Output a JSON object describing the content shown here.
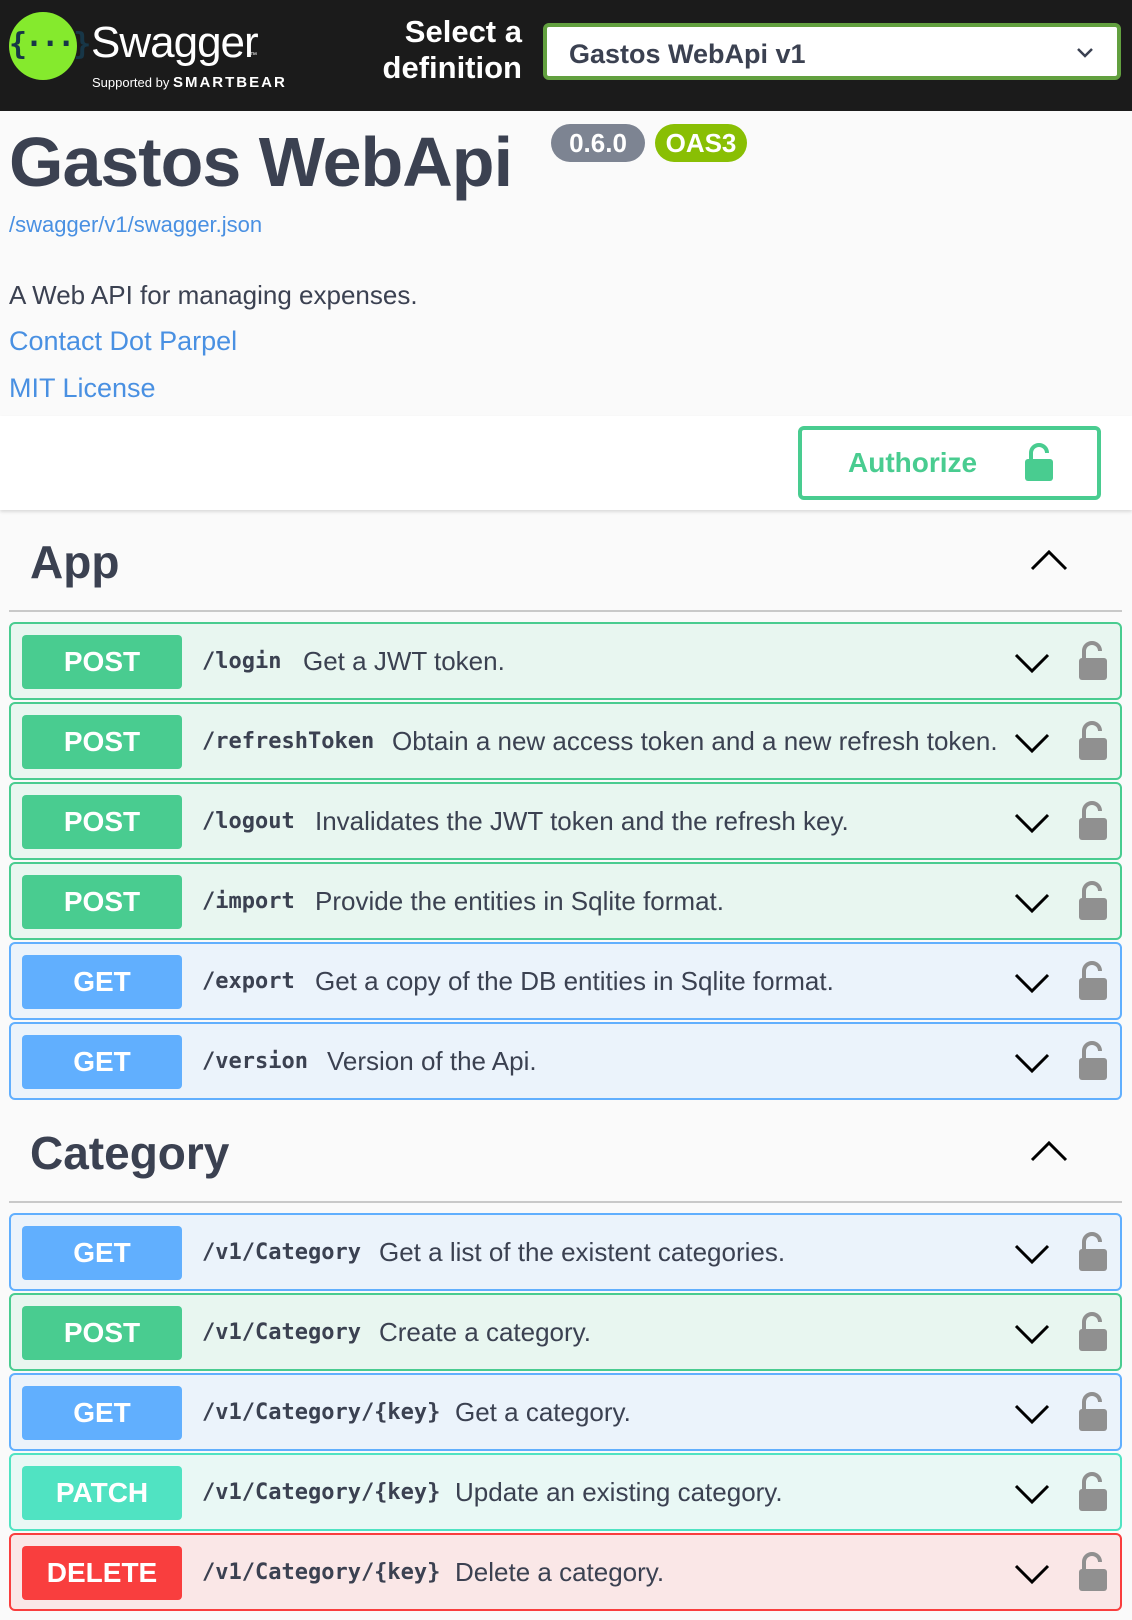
{
  "topbar": {
    "brand": "Swagger",
    "tm": "™",
    "supported_by": "Supported by",
    "company": "SMARTBEAR",
    "select_label_line1": "Select a",
    "select_label_line2": "definition",
    "selected_definition": "Gastos WebApi v1"
  },
  "info": {
    "title": "Gastos WebApi",
    "version": "0.6.0",
    "oas": "OAS3",
    "spec_link": "/swagger/v1/swagger.json",
    "description": "A Web API for managing expenses.",
    "contact": "Contact Dot Parpel",
    "license": "MIT License"
  },
  "auth": {
    "label": "Authorize"
  },
  "colors": {
    "post": "#49cc90",
    "get": "#61affe",
    "patch": "#50e3c2",
    "delete": "#f93e3e"
  },
  "sections": [
    {
      "title": "App",
      "operations": [
        {
          "method": "POST",
          "path": "/login",
          "summary": "Get a JWT token."
        },
        {
          "method": "POST",
          "path": "/refreshToken",
          "summary": "Obtain a new access token and a new refresh token."
        },
        {
          "method": "POST",
          "path": "/logout",
          "summary": "Invalidates the JWT token and the refresh key."
        },
        {
          "method": "POST",
          "path": "/import",
          "summary": "Provide the entities in Sqlite format."
        },
        {
          "method": "GET",
          "path": "/export",
          "summary": "Get a copy of the DB entities in Sqlite format."
        },
        {
          "method": "GET",
          "path": "/version",
          "summary": "Version of the Api."
        }
      ]
    },
    {
      "title": "Category",
      "operations": [
        {
          "method": "GET",
          "path": "/v1/Category",
          "summary": "Get a list of the existent categories."
        },
        {
          "method": "POST",
          "path": "/v1/Category",
          "summary": "Create a category."
        },
        {
          "method": "GET",
          "path": "/v1/Category/{key}",
          "summary": "Get a category."
        },
        {
          "method": "PATCH",
          "path": "/v1/Category/{key}",
          "summary": "Update an existing category."
        },
        {
          "method": "DELETE",
          "path": "/v1/Category/{key}",
          "summary": "Delete a category."
        }
      ]
    }
  ]
}
